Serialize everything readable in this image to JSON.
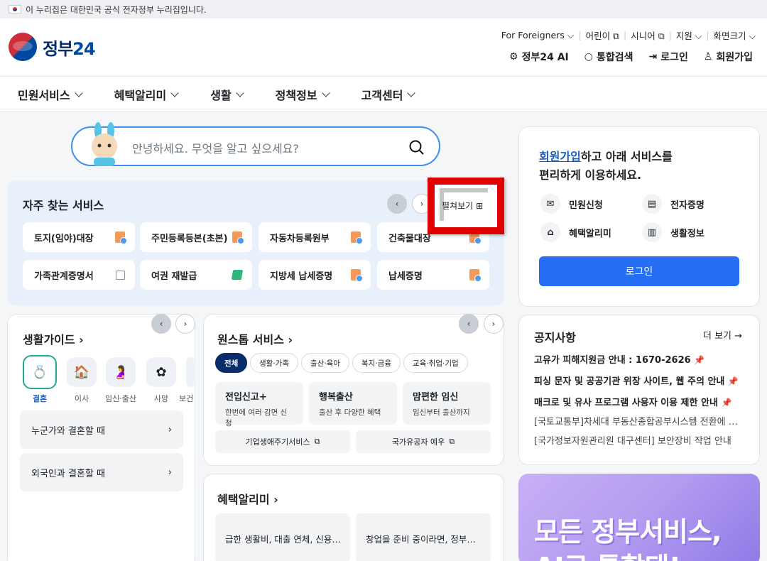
{
  "topbar": {
    "text": "이 누리집은 대한민국 공식 전자정부 누리집입니다."
  },
  "logo": {
    "text": "정부",
    "num": "24"
  },
  "util": {
    "foreigners": "For Foreigners",
    "kids": "어린이",
    "senior": "시니어",
    "support": "지원",
    "zoom": "화면크기"
  },
  "util_main": {
    "ai": "정부24 AI",
    "search": "통합검색",
    "login": "로그인",
    "join": "회원가입"
  },
  "gnb": [
    "민원서비스",
    "혜택알리미",
    "생활",
    "정책정보",
    "고객센터"
  ],
  "search": {
    "placeholder": "안녕하세요. 무엇을 알고 싶으세요?"
  },
  "frequent": {
    "title": "자주 찾는 서비스",
    "expand": "펼쳐보기",
    "items": [
      "토지(임야)대장",
      "주민등록등본(초본)",
      "자동차등록원부",
      "건축물대장",
      "가족관계증명서",
      "여권 재발급",
      "지방세 납세증명",
      "납세증명"
    ]
  },
  "login_card": {
    "join_link": "회원가입",
    "line1": "하고 아래 서비스를",
    "line2": "편리하게 이용하세요.",
    "services": [
      "민원신청",
      "전자증명",
      "혜택알리미",
      "생활정보"
    ],
    "button": "로그인"
  },
  "notice": {
    "title": "공지사항",
    "more": "더 보기",
    "items": [
      "고유가 피해지원금 안내 : 1670-2626",
      "피싱 문자 및 공공기관 위장 사이트, 웹 주의 안내",
      "매크로 및 유사 프로그램 사용자 이용 제한 안내",
      "[국토교통부]차세대 부동산종합공부시스템 전환에 따른…",
      "[국가정보자원관리원 대구센터] 보안장비 작업 안내"
    ]
  },
  "banner": {
    "line1": "모든 정부서비스,",
    "line2": "AI로 통합돼!"
  },
  "life": {
    "title": "생활가이드",
    "icons": [
      "결혼",
      "이사",
      "임신·출산",
      "사망",
      "보건"
    ],
    "rows": [
      "누군가와 결혼할 때",
      "외국인과 결혼할 때"
    ]
  },
  "onestop": {
    "title": "원스톱 서비스",
    "pills": [
      "전체",
      "생활·가족",
      "출산·육아",
      "복지·금융",
      "교육·취업·기업"
    ],
    "cards": [
      {
        "title": "전입신고+",
        "desc": "한번에 여러 감면 신청"
      },
      {
        "title": "행복출산",
        "desc": "출산 후 다양한 혜택"
      },
      {
        "title": "맘편한 임신",
        "desc": "임신부터 출산까지"
      }
    ],
    "links": [
      "기업생애주기서비스",
      "국가유공자 예우"
    ]
  },
  "benefit": {
    "title": "혜택알리미",
    "cards": [
      "급한 생활비, 대출 연체, 신용…",
      "창업을 준비 중이라면, 정부…"
    ]
  },
  "colors": {
    "primary": "#256ef4",
    "navy": "#0b2c6b",
    "highlight": "#e00000"
  }
}
